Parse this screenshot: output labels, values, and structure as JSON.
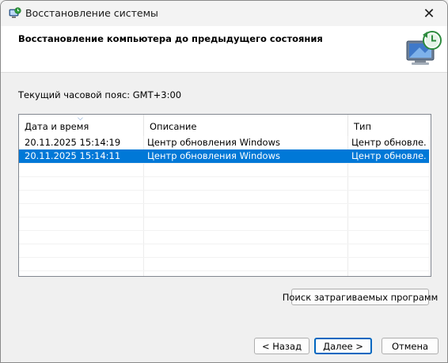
{
  "window": {
    "title": "Восстановление системы",
    "icons": {
      "app": "system-restore-icon",
      "close": "close-icon",
      "header": "computer-restore-icon"
    }
  },
  "header": {
    "title": "Восстановление компьютера до предыдущего состояния"
  },
  "timezone": {
    "text": "Текущий часовой пояс: GMT+3:00"
  },
  "table": {
    "columns": [
      "Дата и время",
      "Описание",
      "Тип"
    ],
    "sort_indicator": "ascending on Дата и время",
    "rows": [
      {
        "date": "20.11.2025 15:14:19",
        "description": "Центр обновления Windows",
        "type": "Центр обновле...",
        "selected": false
      },
      {
        "date": "20.11.2025 15:14:11",
        "description": "Центр обновления Windows",
        "type": "Центр обновле...",
        "selected": true
      }
    ]
  },
  "buttons": {
    "scan": "Поиск затрагиваемых программ",
    "back": "< Назад",
    "next": "Далее >",
    "cancel": "Отмена"
  },
  "colors": {
    "selection": "#0078d7",
    "primary_border": "#0067c0"
  }
}
